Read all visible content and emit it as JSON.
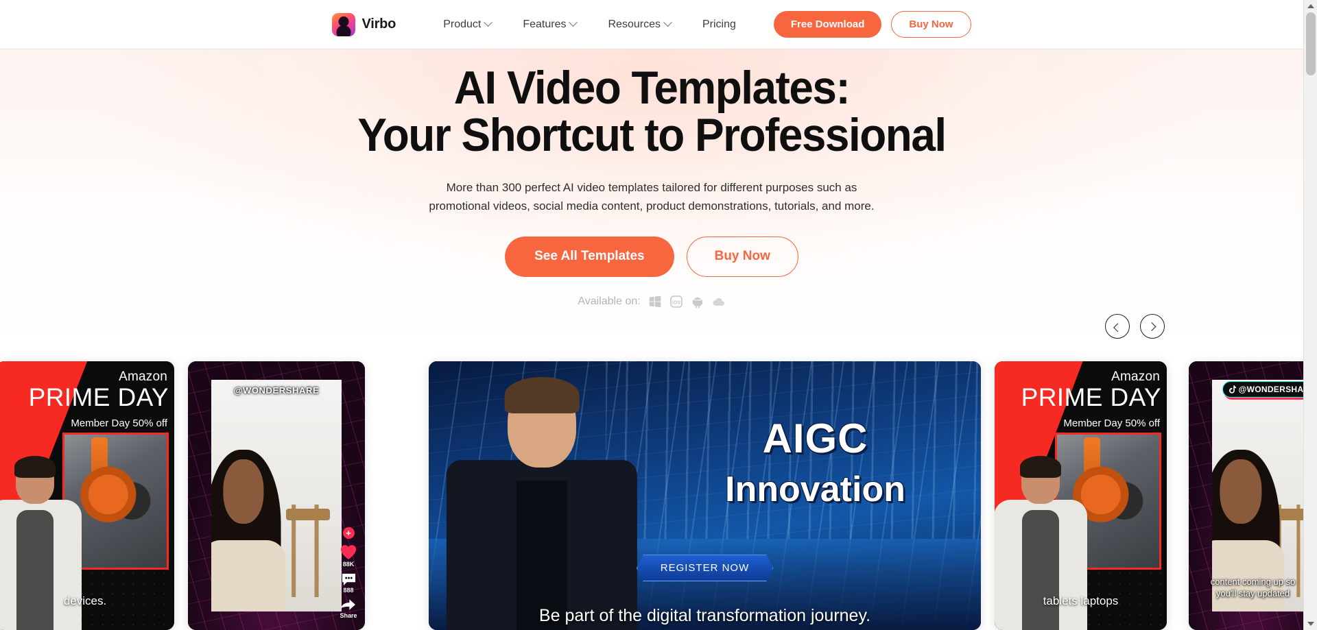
{
  "header": {
    "brand": "Virbo",
    "nav": [
      {
        "label": "Product",
        "has_dropdown": true
      },
      {
        "label": "Features",
        "has_dropdown": true
      },
      {
        "label": "Resources",
        "has_dropdown": true
      },
      {
        "label": "Pricing",
        "has_dropdown": false
      }
    ],
    "free_download": "Free Download",
    "buy_now": "Buy Now"
  },
  "hero": {
    "title_line1": "AI Video Templates:",
    "title_line2": "Your Shortcut to Professional",
    "subtitle_line1": "More than 300 perfect AI video templates tailored for different purposes such as",
    "subtitle_line2": "promotional videos, social media content, product demonstrations, tutorials, and more.",
    "cta_primary": "See All Templates",
    "cta_secondary": "Buy Now",
    "available_label": "Available on:",
    "platforms": [
      "windows-icon",
      "ios-icon",
      "android-icon",
      "cloud-icon"
    ]
  },
  "carousel": {
    "prev_label": "Previous",
    "next_label": "Next",
    "cards": [
      {
        "id": "prime-day-devices",
        "type": "prime-day",
        "amazon": "Amazon",
        "title": "PRIME DAY",
        "member": "Member Day 50% off",
        "caption": "devices."
      },
      {
        "id": "wondershare-tiktok-1",
        "type": "tiktok",
        "handle": "@WONDERSHARE",
        "likes": "88K",
        "comments": "888",
        "share": "Share",
        "plus": "+"
      },
      {
        "id": "aigc-innovation",
        "type": "aigc",
        "title": "AIGC",
        "title2": "Innovation",
        "register": "REGISTER NOW",
        "caption": "Be part of the digital transformation journey."
      },
      {
        "id": "prime-day-tablets",
        "type": "prime-day",
        "amazon": "Amazon",
        "title": "PRIME DAY",
        "member": "Member Day 50% off",
        "caption": "tablets laptops"
      },
      {
        "id": "wondershare-tiktok-2",
        "type": "tiktok-badge",
        "handle": "@WONDERSHAR",
        "caption_line1": "content coming up so",
        "caption_line2": "you'll stay updated"
      }
    ]
  },
  "colors": {
    "accent": "#f8663f",
    "prime_red": "#f62a22",
    "tiktok_pink": "#fe2c55",
    "tiktok_cyan": "#25f4ee",
    "aigc_blue": "#1257a8"
  }
}
